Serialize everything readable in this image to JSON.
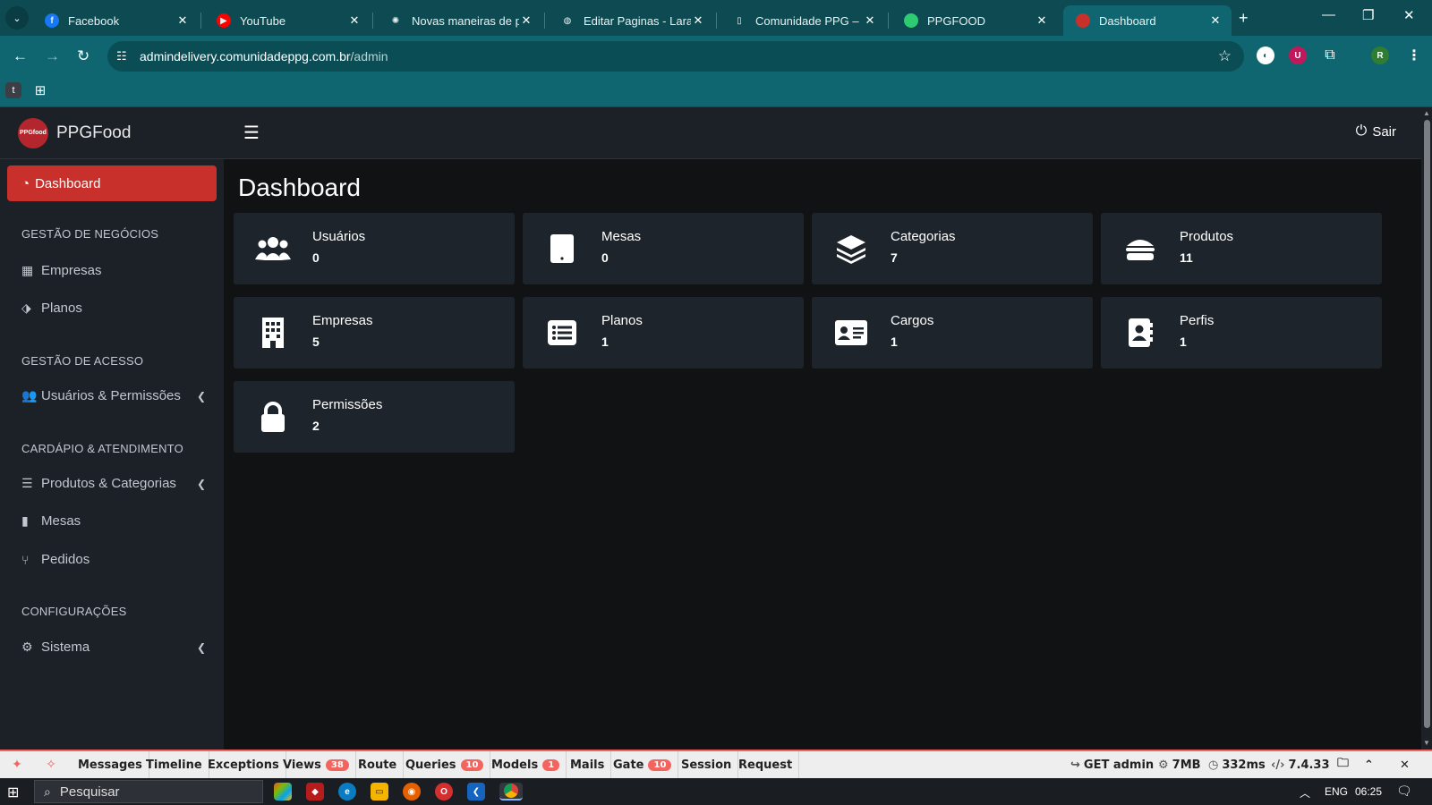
{
  "browser": {
    "tabs": [
      {
        "title": "Facebook",
        "favicon": "facebook-icon",
        "color": "#1877f2",
        "glyph": "f"
      },
      {
        "title": "YouTube",
        "favicon": "youtube-icon",
        "color": "#ff0000",
        "glyph": "▶"
      },
      {
        "title": "Novas maneiras de pro",
        "favicon": "openai-icon",
        "color": "#0d4a52",
        "glyph": "✺"
      },
      {
        "title": "Editar Paginas - Larave",
        "favicon": "globe-icon",
        "color": "#0d4a52",
        "glyph": "◍"
      },
      {
        "title": "Comunidade PPG – En",
        "favicon": "document-icon",
        "color": "#0d4a52",
        "glyph": "▯"
      },
      {
        "title": "PPGFOOD",
        "favicon": "ppgfood-icon",
        "color": "#2ecc71",
        "glyph": ""
      },
      {
        "title": "Dashboard",
        "favicon": "ppgfood-logo-icon",
        "color": "#c8302c",
        "glyph": "",
        "active": true
      }
    ],
    "url_domain": "admindelivery.comunidadeppg.com.br",
    "url_path": "/admin",
    "profile_initial": "R",
    "extension_initial": "U",
    "bookmark_initial": "t"
  },
  "sidebar": {
    "brand": {
      "name_prefix": "PPG",
      "name_suffix": "Food",
      "logo_text": "PPGfood"
    },
    "active_item": {
      "label": "Dashboard",
      "icon": "dashboard-icon"
    },
    "sections": [
      {
        "header": "GESTÃO DE NEGÓCIOS",
        "items": [
          {
            "label": "Empresas",
            "icon": "building-icon"
          },
          {
            "label": "Planos",
            "icon": "tags-icon"
          }
        ]
      },
      {
        "header": "GESTÃO DE ACESSO",
        "items": [
          {
            "label": "Usuários & Permissões",
            "icon": "users-cog-icon",
            "expandable": true
          }
        ]
      },
      {
        "header": "CARDÁPIO & ATENDIMENTO",
        "items": [
          {
            "label": "Produtos & Categorias",
            "icon": "hamburger-icon",
            "expandable": true
          },
          {
            "label": "Mesas",
            "icon": "tablet-icon"
          },
          {
            "label": "Pedidos",
            "icon": "utensils-icon"
          }
        ]
      },
      {
        "header": "CONFIGURAÇÕES",
        "items": [
          {
            "label": "Sistema",
            "icon": "cogs-icon",
            "expandable": true
          }
        ]
      }
    ]
  },
  "topbar": {
    "logout_label": "Sair"
  },
  "main": {
    "title": "Dashboard",
    "cards": [
      {
        "label": "Usuários",
        "value": "0",
        "icon": "users-icon"
      },
      {
        "label": "Mesas",
        "value": "0",
        "icon": "tablet-icon"
      },
      {
        "label": "Categorias",
        "value": "7",
        "icon": "layers-icon"
      },
      {
        "label": "Produtos",
        "value": "11",
        "icon": "hamburger-icon"
      },
      {
        "label": "Empresas",
        "value": "5",
        "icon": "building-icon"
      },
      {
        "label": "Planos",
        "value": "1",
        "icon": "list-icon"
      },
      {
        "label": "Cargos",
        "value": "1",
        "icon": "id-card-icon"
      },
      {
        "label": "Perfis",
        "value": "1",
        "icon": "address-book-icon"
      },
      {
        "label": "Permissões",
        "value": "2",
        "icon": "lock-icon"
      }
    ]
  },
  "debugbar": {
    "tabs": [
      {
        "label": "Messages"
      },
      {
        "label": "Timeline"
      },
      {
        "label": "Exceptions"
      },
      {
        "label": "Views",
        "badge": "38"
      },
      {
        "label": "Route"
      },
      {
        "label": "Queries",
        "badge": "10"
      },
      {
        "label": "Models",
        "badge": "1"
      },
      {
        "label": "Mails"
      },
      {
        "label": "Gate",
        "badge": "10"
      },
      {
        "label": "Session"
      },
      {
        "label": "Request"
      }
    ],
    "request": "GET admin",
    "memory": "7MB",
    "time": "332ms",
    "php_version": "7.4.33"
  },
  "taskbar": {
    "search_placeholder": "Pesquisar",
    "language": "ENG",
    "clock": "06:25"
  },
  "colors": {
    "accent": "#c8302c",
    "debug_accent": "#f4645f",
    "chrome": "#0f6670"
  }
}
